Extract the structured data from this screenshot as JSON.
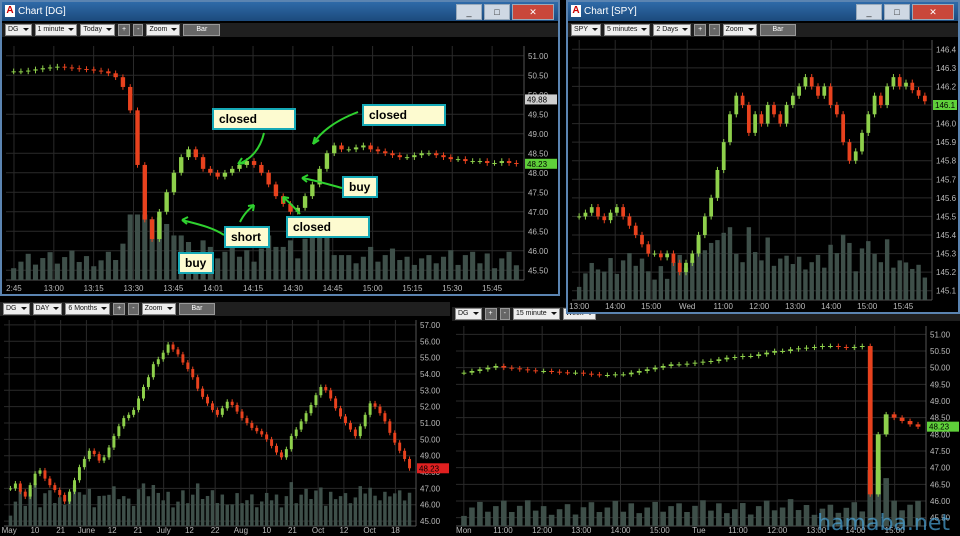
{
  "windows": [
    {
      "title": "Chart [DG]",
      "symbol": "DG",
      "interval": "1 minute",
      "range": "Today",
      "zoom": "Zoom",
      "type": "Bar"
    },
    {
      "title": "Chart [SPY]",
      "symbol": "SPY",
      "interval": "5 minutes",
      "range": "2 Days",
      "zoom": "Zoom",
      "type": "Bar"
    },
    {
      "title": "",
      "symbol": "DG",
      "interval": "DAY",
      "range": "6 Months",
      "zoom": "Zoom",
      "type": "Bar"
    },
    {
      "title": "",
      "symbol": "DG",
      "interval": "15 minute",
      "range": "Week",
      "zoom": "",
      "type": ""
    }
  ],
  "annotations": [
    "closed",
    "closed",
    "buy",
    "short",
    "closed",
    "buy"
  ],
  "watermark": "hamaba.net",
  "colors": {
    "up": "#8ed04b",
    "down": "#e8421e",
    "volume": "#3e4f49",
    "grid": "#2a2a2a",
    "axis": "#bbbbbb"
  },
  "chart_data": [
    {
      "type": "bar",
      "id": "dg-1min",
      "yticks": [
        "51.00",
        "50.50",
        "50.00",
        "49.50",
        "49.00",
        "48.50",
        "48.00",
        "47.50",
        "47.00",
        "46.50",
        "46.00",
        "45.50"
      ],
      "ylim": [
        45.25,
        51.25
      ],
      "xticks": [
        "2:45",
        "13:00",
        "13:15",
        "13:30",
        "13:45",
        "14:01",
        "14:15",
        "14:30",
        "14:45",
        "15:00",
        "15:15",
        "15:30",
        "15:45"
      ],
      "price_labels": [
        "49.88",
        "48.23"
      ],
      "close_series": [
        50.6,
        50.6,
        50.62,
        50.65,
        50.68,
        50.7,
        50.72,
        50.7,
        50.68,
        50.66,
        50.65,
        50.62,
        50.6,
        50.55,
        50.45,
        50.2,
        49.6,
        48.2,
        46.8,
        46.3,
        47.0,
        47.5,
        48.0,
        48.4,
        48.6,
        48.4,
        48.1,
        48.0,
        47.9,
        48.0,
        48.1,
        48.2,
        48.3,
        48.2,
        48.0,
        47.7,
        47.4,
        47.2,
        47.0,
        47.1,
        47.4,
        47.7,
        48.1,
        48.5,
        48.7,
        48.6,
        48.6,
        48.65,
        48.7,
        48.6,
        48.55,
        48.5,
        48.45,
        48.4,
        48.4,
        48.45,
        48.5,
        48.5,
        48.45,
        48.4,
        48.35,
        48.35,
        48.3,
        48.3,
        48.3,
        48.25,
        48.25,
        48.3,
        48.25,
        48.23
      ]
    },
    {
      "type": "bar",
      "id": "spy-5min",
      "yticks": [
        "146.4",
        "146.3",
        "146.2",
        "146.1",
        "146.0",
        "145.9",
        "145.8",
        "145.7",
        "145.6",
        "145.5",
        "145.4",
        "145.3",
        "145.2",
        "145.1"
      ],
      "ylim": [
        145.05,
        146.45
      ],
      "xticks": [
        "13:00",
        "14:00",
        "15:00",
        "Wed",
        "11:00",
        "12:00",
        "13:00",
        "14:00",
        "15:00",
        "15:45"
      ],
      "price_labels": [
        "146.1"
      ],
      "close_series": [
        145.5,
        145.52,
        145.55,
        145.5,
        145.48,
        145.52,
        145.55,
        145.5,
        145.45,
        145.4,
        145.35,
        145.3,
        145.3,
        145.28,
        145.3,
        145.25,
        145.2,
        145.25,
        145.3,
        145.4,
        145.5,
        145.6,
        145.75,
        145.9,
        146.05,
        146.15,
        146.1,
        145.95,
        146.05,
        146.0,
        146.1,
        146.05,
        146.0,
        146.1,
        146.15,
        146.2,
        146.25,
        146.2,
        146.15,
        146.2,
        146.1,
        146.05,
        145.9,
        145.8,
        145.85,
        145.95,
        146.05,
        146.15,
        146.1,
        146.2,
        146.25,
        146.2,
        146.22,
        146.18,
        146.15,
        146.12
      ]
    },
    {
      "type": "bar",
      "id": "dg-daily",
      "yticks": [
        "57.00",
        "56.00",
        "55.00",
        "54.00",
        "53.00",
        "52.00",
        "51.00",
        "50.00",
        "49.00",
        "48.00",
        "47.00",
        "46.00",
        "45.00"
      ],
      "ylim": [
        44.7,
        57.3
      ],
      "xticks": [
        "May",
        "10",
        "21",
        "June",
        "12",
        "21",
        "July",
        "12",
        "22",
        "Aug",
        "10",
        "21",
        "Oct",
        "12",
        "Oct",
        "18"
      ],
      "price_labels": [
        "48.23"
      ],
      "close_series": [
        47.0,
        47.3,
        46.8,
        46.5,
        47.2,
        47.9,
        48.1,
        47.6,
        47.2,
        46.9,
        46.6,
        46.2,
        46.8,
        47.5,
        48.3,
        48.8,
        49.3,
        49.1,
        48.7,
        48.9,
        49.5,
        50.2,
        50.8,
        51.3,
        51.5,
        51.8,
        52.5,
        53.2,
        53.8,
        54.6,
        54.9,
        55.3,
        55.8,
        55.5,
        55.2,
        54.7,
        54.3,
        53.8,
        53.1,
        52.6,
        52.2,
        51.8,
        51.5,
        51.9,
        52.3,
        52.1,
        51.7,
        51.3,
        51.0,
        50.7,
        50.5,
        50.3,
        50.0,
        49.6,
        49.2,
        48.9,
        49.4,
        50.2,
        50.6,
        51.1,
        51.6,
        52.1,
        52.7,
        53.2,
        53.0,
        52.5,
        51.9,
        51.4,
        51.0,
        50.6,
        50.2,
        50.8,
        51.5,
        52.2,
        52.0,
        51.6,
        51.1,
        50.4,
        49.8,
        49.3,
        48.8,
        48.23
      ]
    },
    {
      "type": "bar",
      "id": "dg-15min",
      "yticks": [
        "51.00",
        "50.50",
        "50.00",
        "49.50",
        "49.00",
        "48.50",
        "48.00",
        "47.50",
        "47.00",
        "46.50",
        "46.00",
        "45.50"
      ],
      "ylim": [
        45.25,
        51.25
      ],
      "xticks": [
        "Mon",
        "11:00",
        "12:00",
        "13:00",
        "14:00",
        "15:00",
        "Tue",
        "11:00",
        "12:00",
        "13:00",
        "14:00",
        "15:00"
      ],
      "price_labels": [
        "48.23"
      ],
      "close_series": [
        49.85,
        49.9,
        49.95,
        50.0,
        50.05,
        50.0,
        49.98,
        49.95,
        49.92,
        49.9,
        49.9,
        49.88,
        49.86,
        49.85,
        49.85,
        49.82,
        49.8,
        49.78,
        49.78,
        49.8,
        49.8,
        49.85,
        49.9,
        49.95,
        50.0,
        50.05,
        50.1,
        50.1,
        50.12,
        50.15,
        50.18,
        50.2,
        50.25,
        50.3,
        50.32,
        50.35,
        50.35,
        50.4,
        50.45,
        50.5,
        50.5,
        50.55,
        50.58,
        50.6,
        50.62,
        50.65,
        50.65,
        50.62,
        50.6,
        50.62,
        50.65,
        46.2,
        48.0,
        48.6,
        48.5,
        48.4,
        48.3,
        48.23
      ]
    }
  ]
}
